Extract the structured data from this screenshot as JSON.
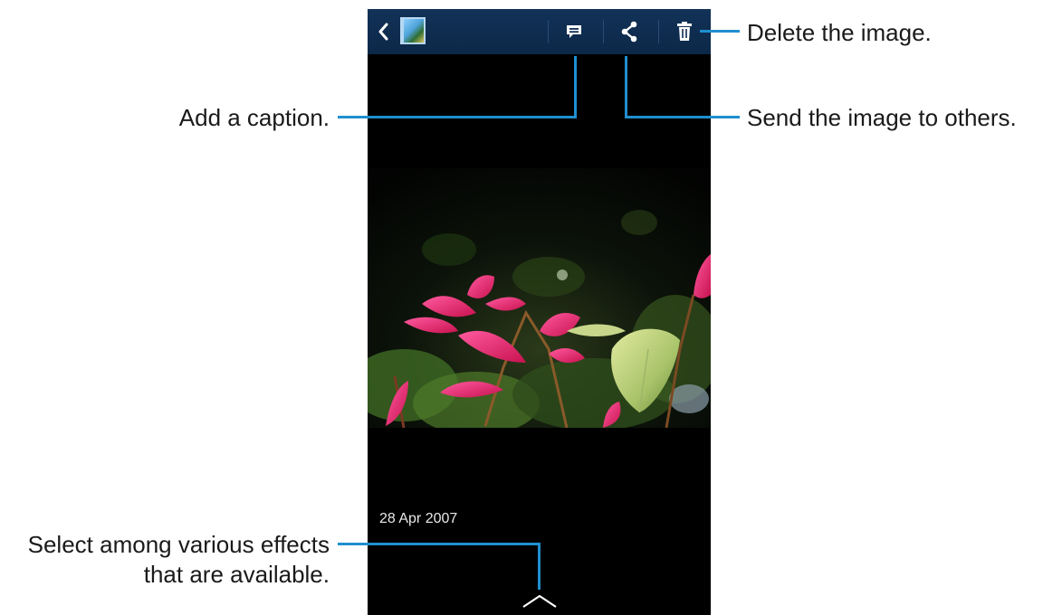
{
  "screen": {
    "action_bar": {
      "back_icon": "chevron-left-icon",
      "thumbnail_icon": "album-thumbnail-icon",
      "actions": [
        {
          "name": "caption",
          "icon": "comment-icon"
        },
        {
          "name": "share",
          "icon": "share-icon"
        },
        {
          "name": "delete",
          "icon": "trash-icon"
        }
      ],
      "background_color": "#0f2d52"
    },
    "photo_date": "28 Apr 2007",
    "effects_handle_icon": "chevron-up-icon"
  },
  "callouts": {
    "delete": "Delete the image.",
    "caption": "Add a caption.",
    "share": "Send the image to others.",
    "effects_line1": "Select among various effects",
    "effects_line2": "that are available."
  },
  "colors": {
    "callout_line": "#1f8fcf",
    "accent_leaf": "#e0286a"
  }
}
